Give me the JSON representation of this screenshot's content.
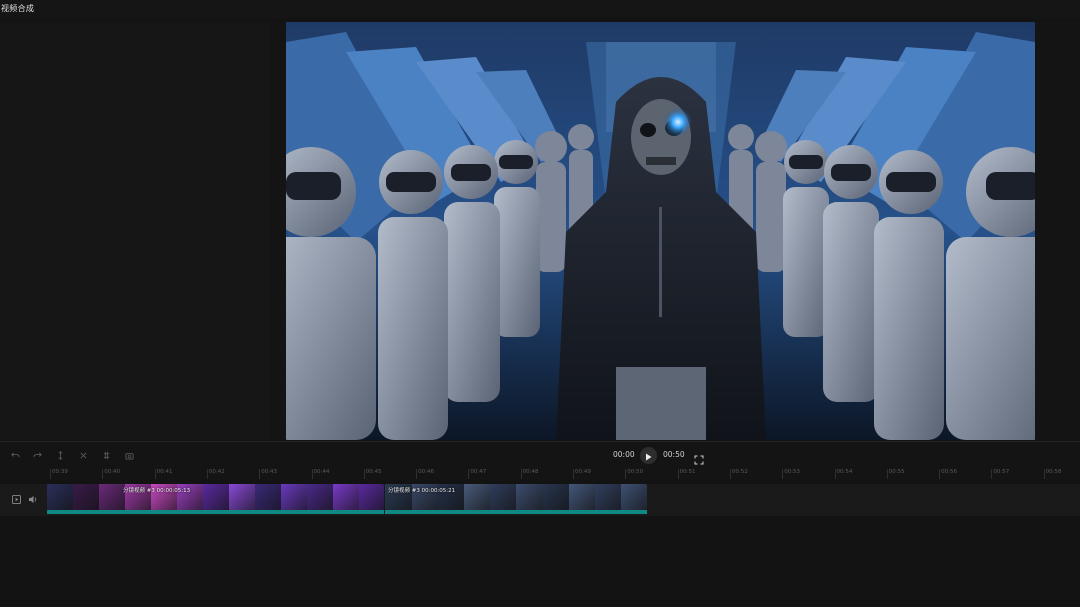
{
  "app": {
    "title": "视频合成"
  },
  "player": {
    "current_time": "00:00",
    "total_time": "00:50"
  },
  "toolbar": {
    "icons": [
      "undo-icon",
      "redo-icon",
      "split-icon",
      "delete-icon",
      "trim-icon",
      "screenshot-icon"
    ]
  },
  "ruler": {
    "ticks": [
      "00:39",
      "00:40",
      "00:41",
      "00:42",
      "00:43",
      "00:44",
      "00:45",
      "00:46",
      "00:47",
      "00:48",
      "00:49",
      "00:50",
      "00:51",
      "00:52",
      "00:53",
      "00:54",
      "00:55",
      "00:56",
      "00:57",
      "00:58"
    ]
  },
  "track": {
    "clips": [
      {
        "label": "分镜视频 #3 00:00:05:13"
      },
      {
        "label": "分镜视频 #3 00:00:05:21"
      }
    ]
  },
  "colors": {
    "accent": "#0f8a82",
    "background": "#131313",
    "track_bg": "#1a1a1a"
  }
}
